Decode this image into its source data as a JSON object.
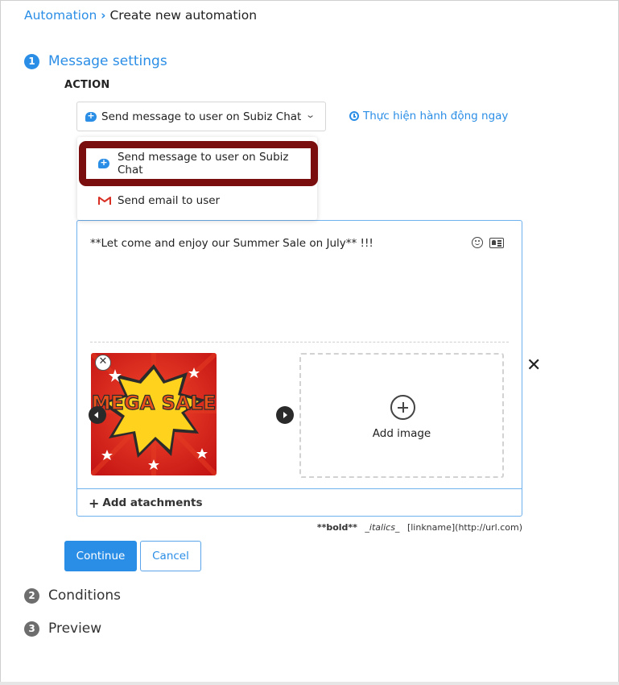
{
  "breadcrumb": {
    "parent": "Automation",
    "separator": "›",
    "current": "Create new automation"
  },
  "steps": [
    {
      "number": "1",
      "title": "Message settings"
    },
    {
      "number": "2",
      "title": "Conditions"
    },
    {
      "number": "3",
      "title": "Preview"
    }
  ],
  "action": {
    "label": "ACTION",
    "selected": "Send message to user on Subiz Chat",
    "run_now_link": "Thực hiện hành động ngay",
    "options": [
      {
        "label": "Send message to user on Subiz Chat",
        "icon": "chat-icon"
      },
      {
        "label": "Send email to user",
        "icon": "gmail-icon"
      }
    ]
  },
  "editor": {
    "message_text": "**Let come and enjoy our Summer Sale on July** !!!",
    "image_text": "MEGA SALE",
    "add_image_label": "Add image",
    "add_attachments_label": "Add atachments",
    "close_symbol": "✕",
    "remove_symbol": "✕"
  },
  "format_hint": {
    "bold": "**bold**",
    "italics": "_italics_",
    "link": "[linkname](http://url.com)"
  },
  "buttons": {
    "continue": "Continue",
    "cancel": "Cancel"
  },
  "colors": {
    "accent": "#2b8ee6",
    "highlight_border": "#7a0d0d",
    "step_inactive": "#6d6d6d"
  }
}
